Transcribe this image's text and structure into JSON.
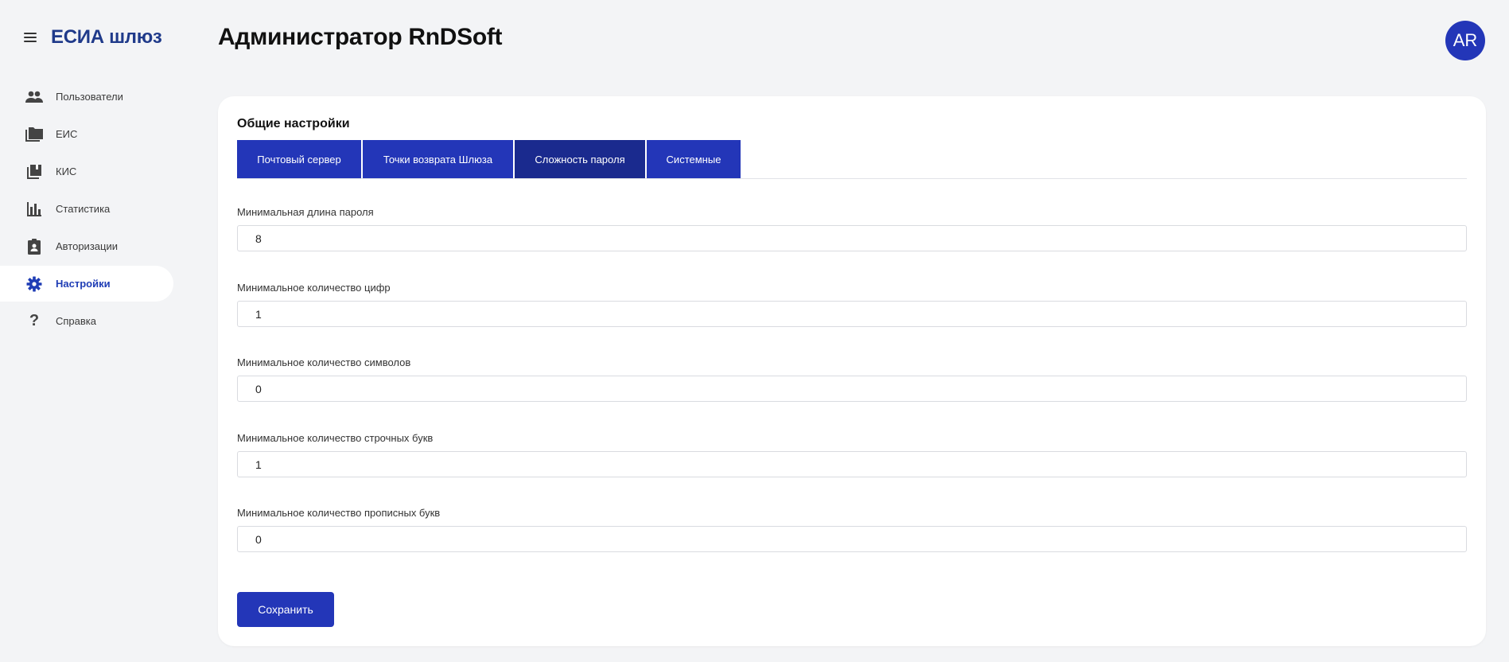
{
  "app": {
    "title": "ЕСИА шлюз"
  },
  "sidebar": {
    "items": [
      {
        "label": "Пользователи",
        "icon": "users-icon"
      },
      {
        "label": "ЕИС",
        "icon": "folder-icon"
      },
      {
        "label": "КИС",
        "icon": "library-icon"
      },
      {
        "label": "Статистика",
        "icon": "bar-chart-icon"
      },
      {
        "label": "Авторизации",
        "icon": "clipboard-icon"
      },
      {
        "label": "Настройки",
        "icon": "gear-icon",
        "active": true
      },
      {
        "label": "Справка",
        "icon": "question-icon"
      }
    ]
  },
  "header": {
    "title": "Администратор RnDSoft",
    "avatar_initials": "AR"
  },
  "settings": {
    "section_title": "Общие настройки",
    "tabs": [
      {
        "label": "Почтовый сервер"
      },
      {
        "label": "Точки возврата Шлюза"
      },
      {
        "label": "Сложность пароля",
        "active": true
      },
      {
        "label": "Системные"
      }
    ],
    "fields": [
      {
        "label": "Минимальная длина пароля",
        "value": "8"
      },
      {
        "label": "Минимальное количество цифр",
        "value": "1"
      },
      {
        "label": "Минимальное количество символов",
        "value": "0"
      },
      {
        "label": "Минимальное количество строчных букв",
        "value": "1"
      },
      {
        "label": "Минимальное количество прописных букв",
        "value": "0"
      }
    ],
    "save_label": "Сохранить"
  },
  "colors": {
    "accent": "#2336b8",
    "accent_active": "#1a2a8e",
    "brand_title": "#1f3a8a",
    "background": "#f3f4f6"
  }
}
